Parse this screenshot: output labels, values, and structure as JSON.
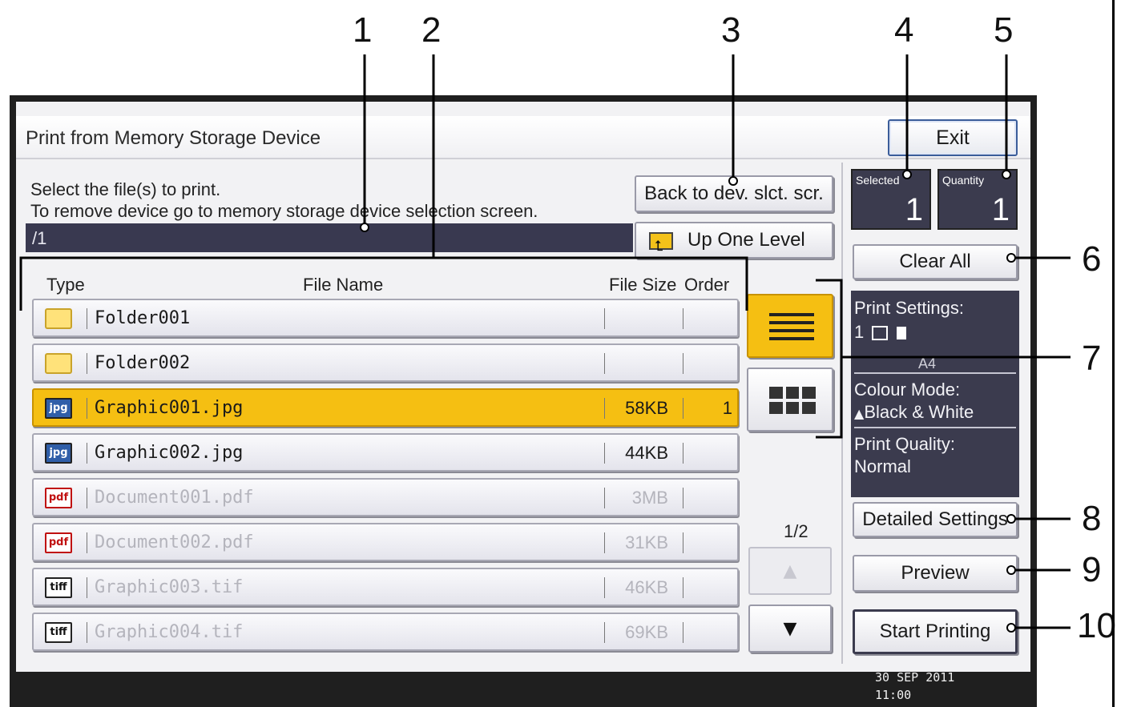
{
  "callouts": [
    "1",
    "2",
    "3",
    "4",
    "5",
    "6",
    "7",
    "8",
    "9",
    "10"
  ],
  "window": {
    "title": "Print from Memory Storage Device",
    "exit_label": "Exit"
  },
  "instructions": {
    "line1": "Select the file(s) to print.",
    "line2": "To remove device go to memory storage device selection screen."
  },
  "path": "/1",
  "nav": {
    "back_label": "Back to dev. slct. scr.",
    "up_label": "Up One Level"
  },
  "columns": {
    "type": "Type",
    "name": "File Name",
    "size": "File Size",
    "order": "Order"
  },
  "files": [
    {
      "icon": "folder-icon",
      "name": "Folder001",
      "size": "",
      "order": "",
      "state": "normal"
    },
    {
      "icon": "folder-icon",
      "name": "Folder002",
      "size": "",
      "order": "",
      "state": "normal"
    },
    {
      "icon": "jpg-icon",
      "type_label": "jpg",
      "name": "Graphic001.jpg",
      "size": "58KB",
      "order": "1",
      "state": "selected"
    },
    {
      "icon": "jpg-icon",
      "type_label": "jpg",
      "name": "Graphic002.jpg",
      "size": "44KB",
      "order": "",
      "state": "normal"
    },
    {
      "icon": "pdf-icon",
      "type_label": "pdf",
      "name": "Document001.pdf",
      "size": "3MB",
      "order": "",
      "state": "disabled"
    },
    {
      "icon": "pdf-icon",
      "type_label": "pdf",
      "name": "Document002.pdf",
      "size": "31KB",
      "order": "",
      "state": "disabled"
    },
    {
      "icon": "tiff-icon",
      "type_label": "tiff",
      "name": "Graphic003.tif",
      "size": "46KB",
      "order": "",
      "state": "disabled"
    },
    {
      "icon": "tiff-icon",
      "type_label": "tiff",
      "name": "Graphic004.tif",
      "size": "69KB",
      "order": "",
      "state": "disabled"
    }
  ],
  "pager": {
    "page": "1/2",
    "up_glyph": "▲",
    "down_glyph": "▼"
  },
  "counters": {
    "selected_label": "Selected",
    "selected_value": "1",
    "quantity_label": "Quantity",
    "quantity_value": "1"
  },
  "actions": {
    "clear_all": "Clear All",
    "detailed_settings": "Detailed Settings",
    "preview": "Preview",
    "start_printing": "Start Printing"
  },
  "print_settings": {
    "label": "Print Settings:",
    "copies": "1",
    "paper": "A4",
    "colour_label": "Colour Mode:",
    "colour_value": "Black & White",
    "quality_label": "Print Quality:",
    "quality_value": "Normal"
  },
  "status": {
    "date": "30 SEP  2011",
    "time": "11:00"
  },
  "colors": {
    "accent": "#f5bf12",
    "panel": "#3b3b4e",
    "screen_frame": "#1f1f1f"
  }
}
